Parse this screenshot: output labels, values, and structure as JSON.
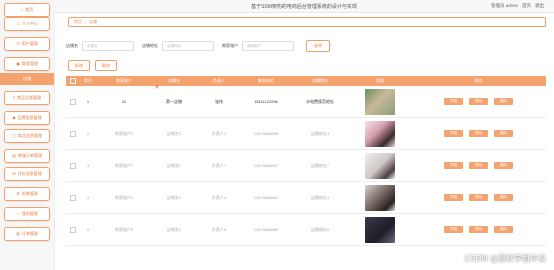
{
  "header": {
    "title": "基于SSM架构的电商后台管理系统的设计与实现",
    "user_text": "管理员 admin",
    "home_link": "首页",
    "logout_link": "退出"
  },
  "sidebar": {
    "items": [
      {
        "label": "首页",
        "icon": "home-icon"
      },
      {
        "label": "个人中心",
        "icon": "user-icon"
      },
      {
        "label": "用户管理",
        "icon": "users-icon"
      },
      {
        "label": "商家管理",
        "icon": "shop-icon"
      },
      {
        "label": "店铺",
        "icon": "store-icon",
        "active": true
      },
      {
        "label": "商品分类管理",
        "icon": "list-icon"
      },
      {
        "label": "品牌信息管理",
        "icon": "tag-icon"
      },
      {
        "label": "商品信息管理",
        "icon": "box-icon"
      },
      {
        "label": "商城订单管理",
        "icon": "order-icon"
      },
      {
        "label": "评价信息管理",
        "icon": "comment-icon"
      },
      {
        "label": "系统管理",
        "icon": "gear-icon"
      },
      {
        "label": "我的管理",
        "icon": "star-icon"
      },
      {
        "label": "订单管理",
        "icon": "file-icon"
      }
    ]
  },
  "breadcrumb": {
    "home": "首页",
    "current": "店铺"
  },
  "search": {
    "fields": [
      {
        "label": "店铺名",
        "placeholder": "店铺名"
      },
      {
        "label": "店铺地址",
        "placeholder": "店铺地址"
      },
      {
        "label": "商家账户",
        "placeholder": "商家账户"
      }
    ],
    "button": "查询"
  },
  "actions": {
    "add": "新增",
    "delete": "删除"
  },
  "table": {
    "headers": [
      "索引",
      "商家账户",
      "店铺名",
      "负责人",
      "联系电话",
      "店铺地址",
      "封面",
      "操作"
    ],
    "rows": [
      {
        "idx": "1",
        "account": "22",
        "name": "第一店铺",
        "person": "张伟",
        "phone": "15111122296",
        "addr": "水电费规范地址",
        "photo": "building",
        "dim": false
      },
      {
        "idx": "2",
        "account": "商家账户3",
        "name": "店铺名3",
        "person": "负责人3",
        "phone": "13823888888",
        "addr": "店铺地址3",
        "photo": "girl-pink",
        "dim": true
      },
      {
        "idx": "3",
        "account": "商家账户7",
        "name": "店铺名7",
        "person": "负责人7",
        "phone": "13823888887",
        "addr": "店铺地址7",
        "photo": "girl-white",
        "dim": true
      },
      {
        "idx": "4",
        "account": "商家账户4",
        "name": "店铺名4",
        "person": "负责人4",
        "phone": "13823888884",
        "addr": "店铺地址4",
        "photo": "girl-dark",
        "dim": true
      },
      {
        "idx": "5",
        "account": "商家账户5",
        "name": "店铺名5",
        "person": "负责人5",
        "phone": "13823888885",
        "addr": "店铺地址5",
        "photo": "girl-night",
        "dim": true
      }
    ],
    "op_buttons": [
      "详情",
      "修改",
      "删除"
    ]
  },
  "watermark": "CSDN @亚欣学姐毕设",
  "colors": {
    "accent": "#f4a36e",
    "accent_text": "#f08a4b"
  }
}
